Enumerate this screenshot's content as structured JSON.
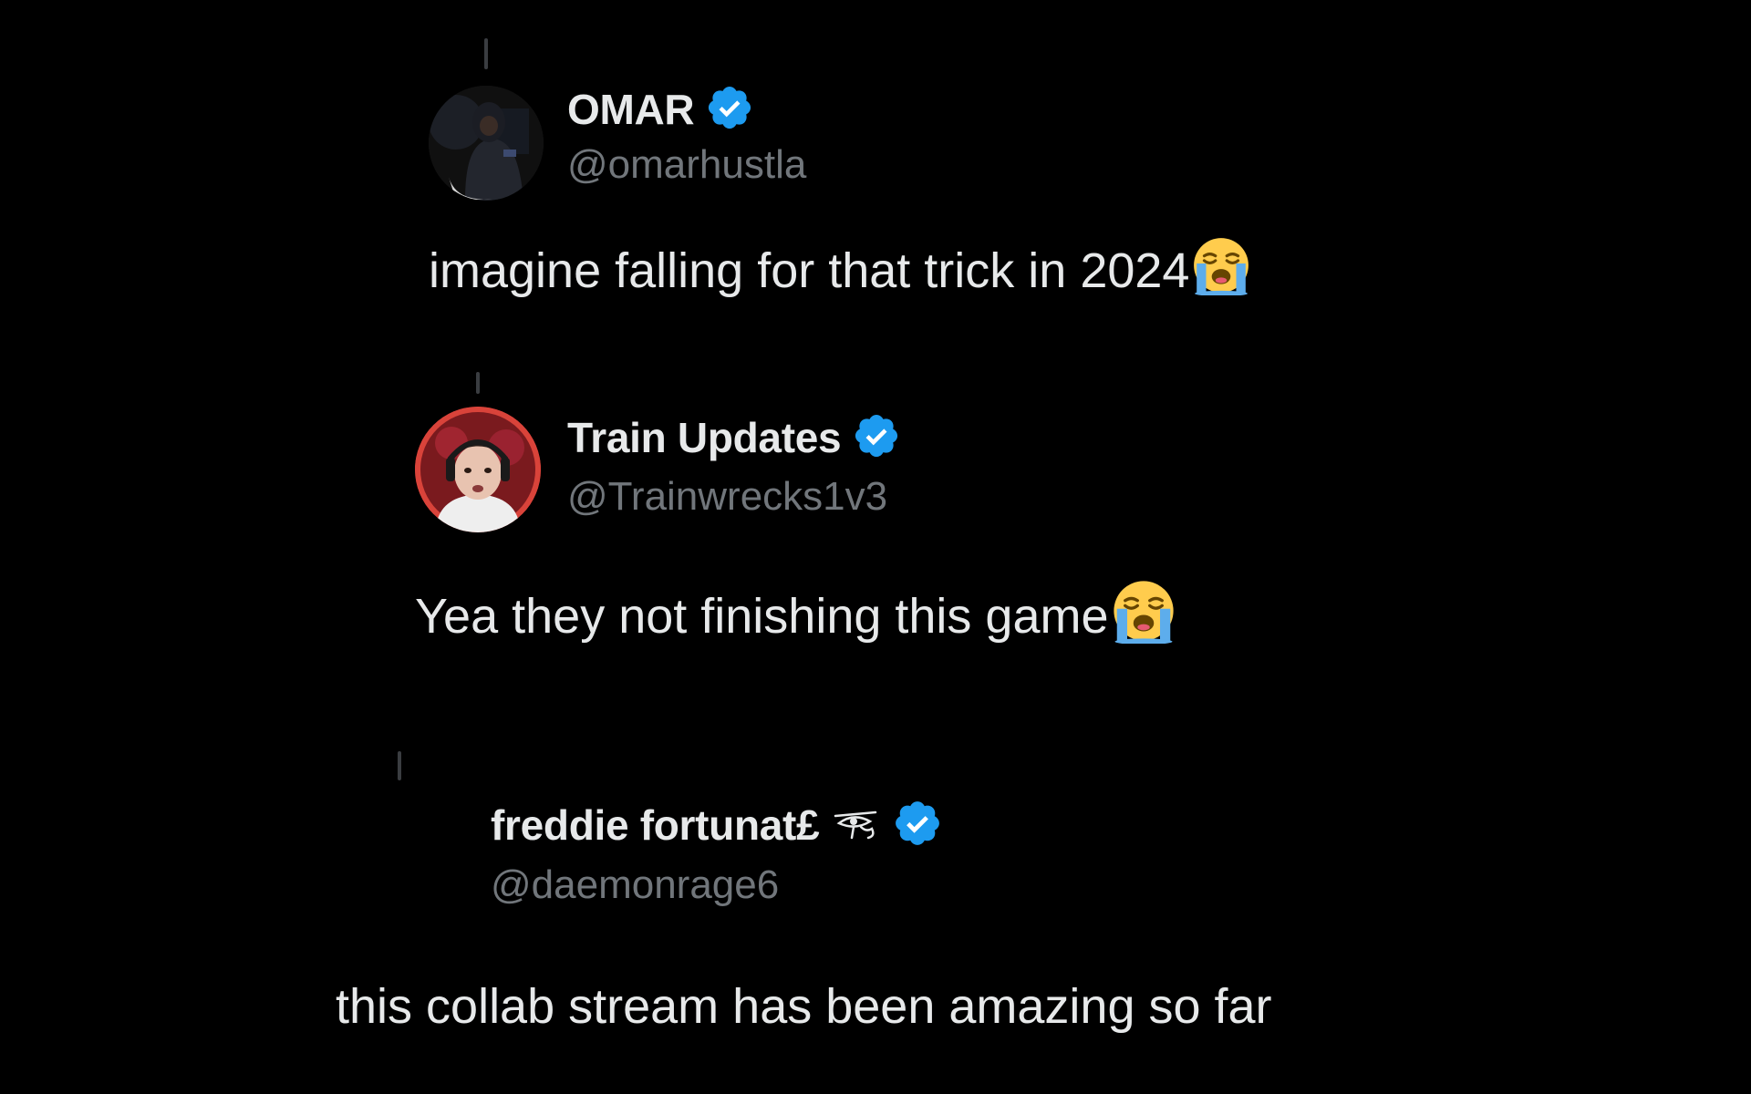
{
  "tweets": [
    {
      "display_name": "OMAR",
      "handle": "@omarhustla",
      "text": "imagine falling for that trick in 2024",
      "verified": true,
      "emoji": "loudly-crying-face"
    },
    {
      "display_name": "Train Updates",
      "handle": "@Trainwrecks1v3",
      "text": "Yea they not finishing this game",
      "verified": true,
      "emoji": "loudly-crying-face"
    },
    {
      "display_name": "freddie fortunat£",
      "handle": "@daemonrage6",
      "text": "this collab stream has been amazing so far",
      "verified": true,
      "name_icon": "eye-of-horus-icon"
    }
  ],
  "colors": {
    "background": "#000000",
    "text": "#e7e9ea",
    "handle": "#71767b",
    "verified": "#1d9bf0"
  }
}
